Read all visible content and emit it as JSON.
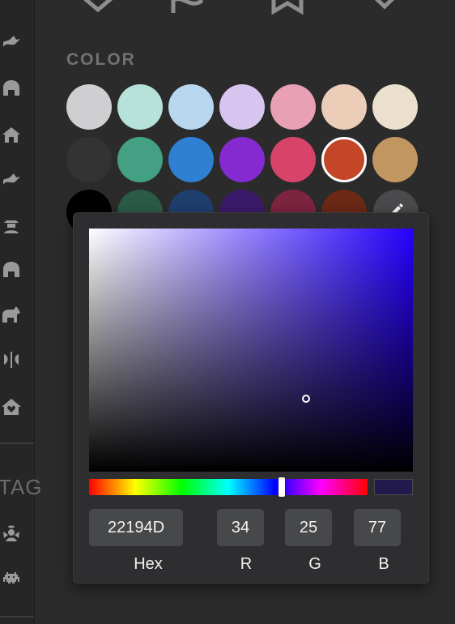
{
  "left_rail": {
    "tag_label": "TAG",
    "icons": [
      "dragon-icon",
      "gopuram-icon",
      "house-icon",
      "dragon-icon",
      "cowboy-icon",
      "gopuram-icon",
      "hippo-icon",
      "axe-icon",
      "house-heart-icon",
      "angel-icon",
      "space-invader-icon"
    ]
  },
  "color_section": {
    "title": "COLOR"
  },
  "swatches": {
    "row1": [
      "#cfcfd1",
      "#b6e2d9",
      "#b8d7ef",
      "#d8c5ef",
      "#e8a0b4",
      "#ebcdb8",
      "#ebe0cd"
    ],
    "row2": [
      "#333333",
      "#43a083",
      "#2f7fd3",
      "#852ad0",
      "#d8436a",
      "#c44628",
      "#c29661"
    ],
    "row3": [
      "#000000",
      "#2b5b47",
      "#1e3e6e",
      "#3c1a6a",
      "#7d2440",
      "#6b2916"
    ],
    "selected_color": "#c44628"
  },
  "picker": {
    "hex": "22194D",
    "r": "34",
    "g": "25",
    "b": "77",
    "hex_label": "Hex",
    "r_label": "R",
    "g_label": "G",
    "b_label": "B",
    "preview_color": "#22194d",
    "hue_degrees": 249,
    "saturation": 0.67,
    "brightness": 0.3
  }
}
